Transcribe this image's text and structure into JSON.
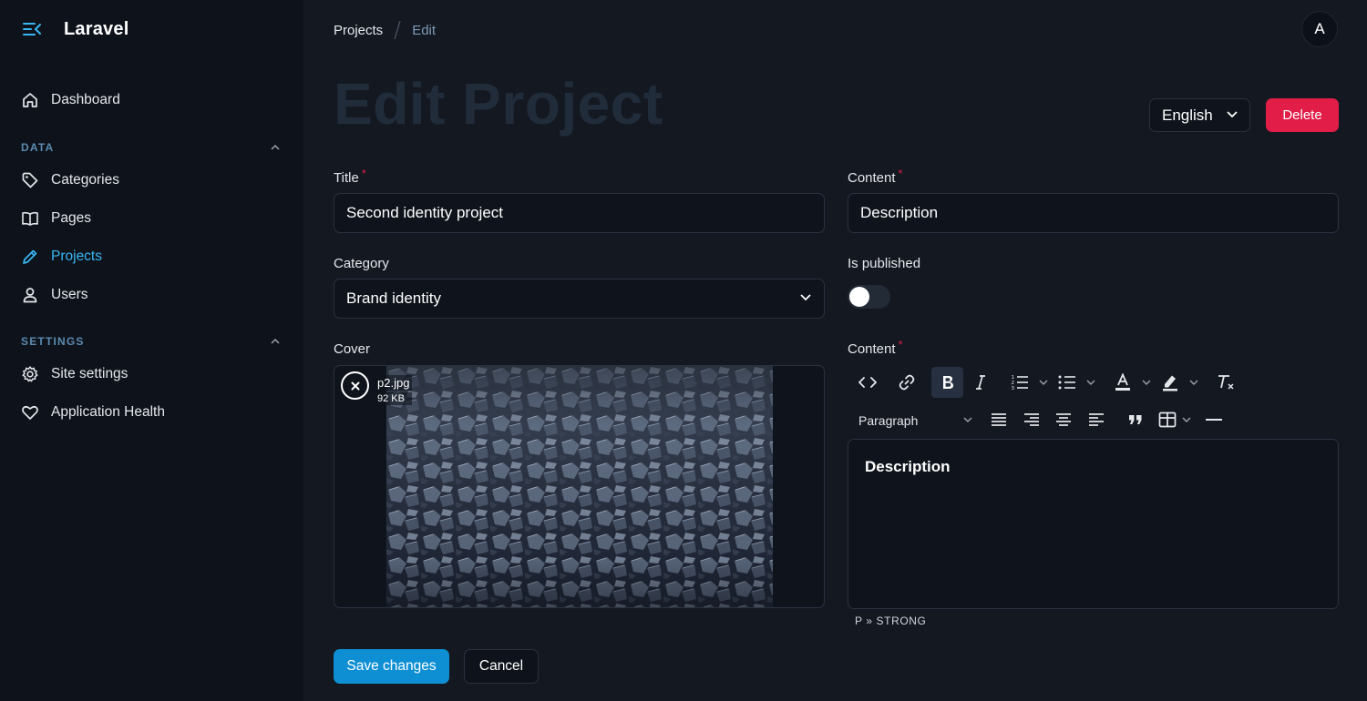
{
  "app": {
    "name": "Laravel"
  },
  "sidebar": {
    "dashboard": "Dashboard",
    "groups": [
      {
        "label": "DATA",
        "items": [
          "Categories",
          "Pages",
          "Projects",
          "Users"
        ]
      },
      {
        "label": "SETTINGS",
        "items": [
          "Site settings",
          "Application Health"
        ]
      }
    ],
    "active_item": "Projects"
  },
  "breadcrumb": {
    "items": [
      "Projects",
      "Edit"
    ]
  },
  "user": {
    "initial": "A"
  },
  "page": {
    "title": "Edit Project"
  },
  "language": {
    "selected": "English"
  },
  "actions": {
    "delete": "Delete",
    "save": "Save changes",
    "cancel": "Cancel"
  },
  "form": {
    "title": {
      "label": "Title",
      "required": "*",
      "value": "Second identity project"
    },
    "content_short": {
      "label": "Content",
      "required": "*",
      "value": "Description"
    },
    "category": {
      "label": "Category",
      "value": "Brand identity"
    },
    "is_published": {
      "label": "Is published",
      "value": false
    },
    "cover": {
      "label": "Cover",
      "file_name": "p2.jpg",
      "file_size": "92 KB"
    },
    "content": {
      "label": "Content",
      "required": "*",
      "block_format": "Paragraph",
      "body": "Description",
      "path": "P » STRONG"
    }
  },
  "colors": {
    "accent": "#38b6f4",
    "danger": "#e11d48",
    "primary_button": "#0e8fd4",
    "background": "#141821",
    "sidebar": "#0e131b"
  }
}
